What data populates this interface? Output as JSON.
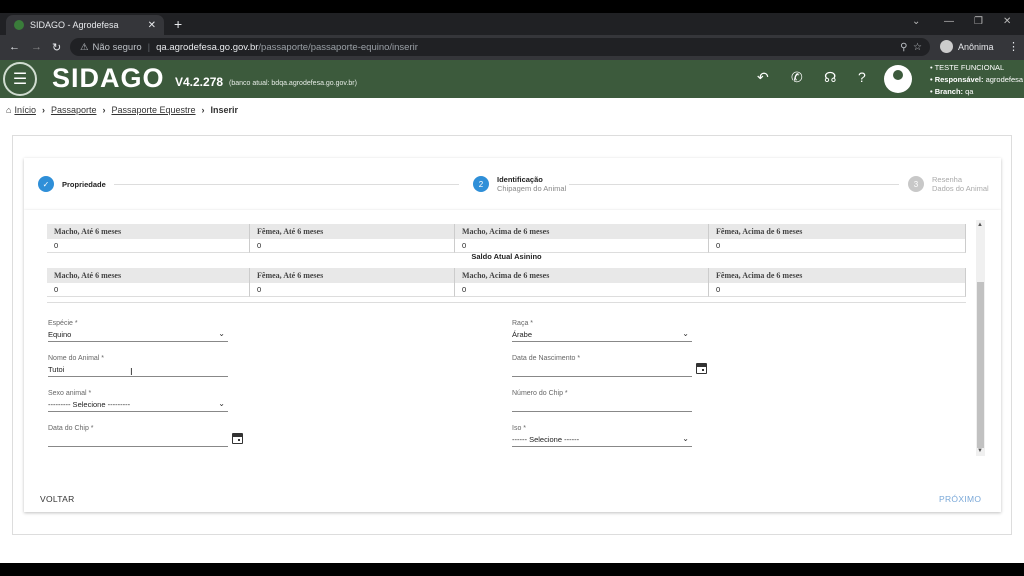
{
  "browser": {
    "tab_title": "SIDAGO - Agrodefesa",
    "tab_close": "✕",
    "new_tab": "+",
    "security_label": "Não seguro",
    "url_host": "qa.agrodefesa.go.gov.br",
    "url_path": "/passaporte/passaporte-equino/inserir",
    "profile_label": "Anônima"
  },
  "header": {
    "logo": "SIDAGO",
    "version": "V4.2.278",
    "banco": "(banco atual: bdqa.agrodefesa.go.gov.br)",
    "user_line1": "• TESTE FUNCIONAL",
    "user_line2_label": "• Responsável:",
    "user_line2_value": "agrodefesa",
    "user_line3_label": "• Branch:",
    "user_line3_value": "qa",
    "icons": [
      "undo-icon",
      "phone-icon",
      "headset-icon",
      "help-icon",
      "user-icon"
    ]
  },
  "breadcrumb": {
    "items": [
      "Início",
      "Passaporte",
      "Passaporte Equestre"
    ],
    "current": "Inserir"
  },
  "stepper": {
    "steps": [
      {
        "label": "Propriedade",
        "sub": "",
        "state": "done"
      },
      {
        "label": "Identificação",
        "sub": "Chipagem do Animal",
        "state": "active",
        "number": "2"
      },
      {
        "label": "Resenha",
        "sub": "Dados do Animal",
        "state": "disabled",
        "number": "3"
      }
    ]
  },
  "saldo": {
    "table1": {
      "headers": [
        "Macho, Até 6 meses",
        "Fêmea, Até 6 meses",
        "Macho, Acima de 6 meses",
        "Fêmea, Acima de 6 meses"
      ],
      "values": [
        "0",
        "0",
        "0",
        "0"
      ]
    },
    "title2": "Saldo Atual Asinino",
    "table2": {
      "headers": [
        "Macho, Até 6 meses",
        "Fêmea, Até 6 meses",
        "Macho, Acima de 6 meses",
        "Fêmea, Acima de 6 meses"
      ],
      "values": [
        "0",
        "0",
        "0",
        "0"
      ]
    }
  },
  "form": {
    "especie": {
      "label": "Espécie *",
      "value": "Equino"
    },
    "raca": {
      "label": "Raça *",
      "value": "Árabe"
    },
    "nome": {
      "label": "Nome do Animal *",
      "value": "Tutoi"
    },
    "nascimento": {
      "label": "Data de Nascimento *",
      "value": ""
    },
    "sexo": {
      "label": "Sexo animal *",
      "value": "--------- Selecione ---------"
    },
    "chip": {
      "label": "Número do Chip *",
      "value": ""
    },
    "data_chip": {
      "label": "Data do Chip *",
      "value": ""
    },
    "iso": {
      "label": "Iso *",
      "value": "------ Selecione ------"
    }
  },
  "actions": {
    "back": "VOLTAR",
    "next": "PRÓXIMO"
  }
}
